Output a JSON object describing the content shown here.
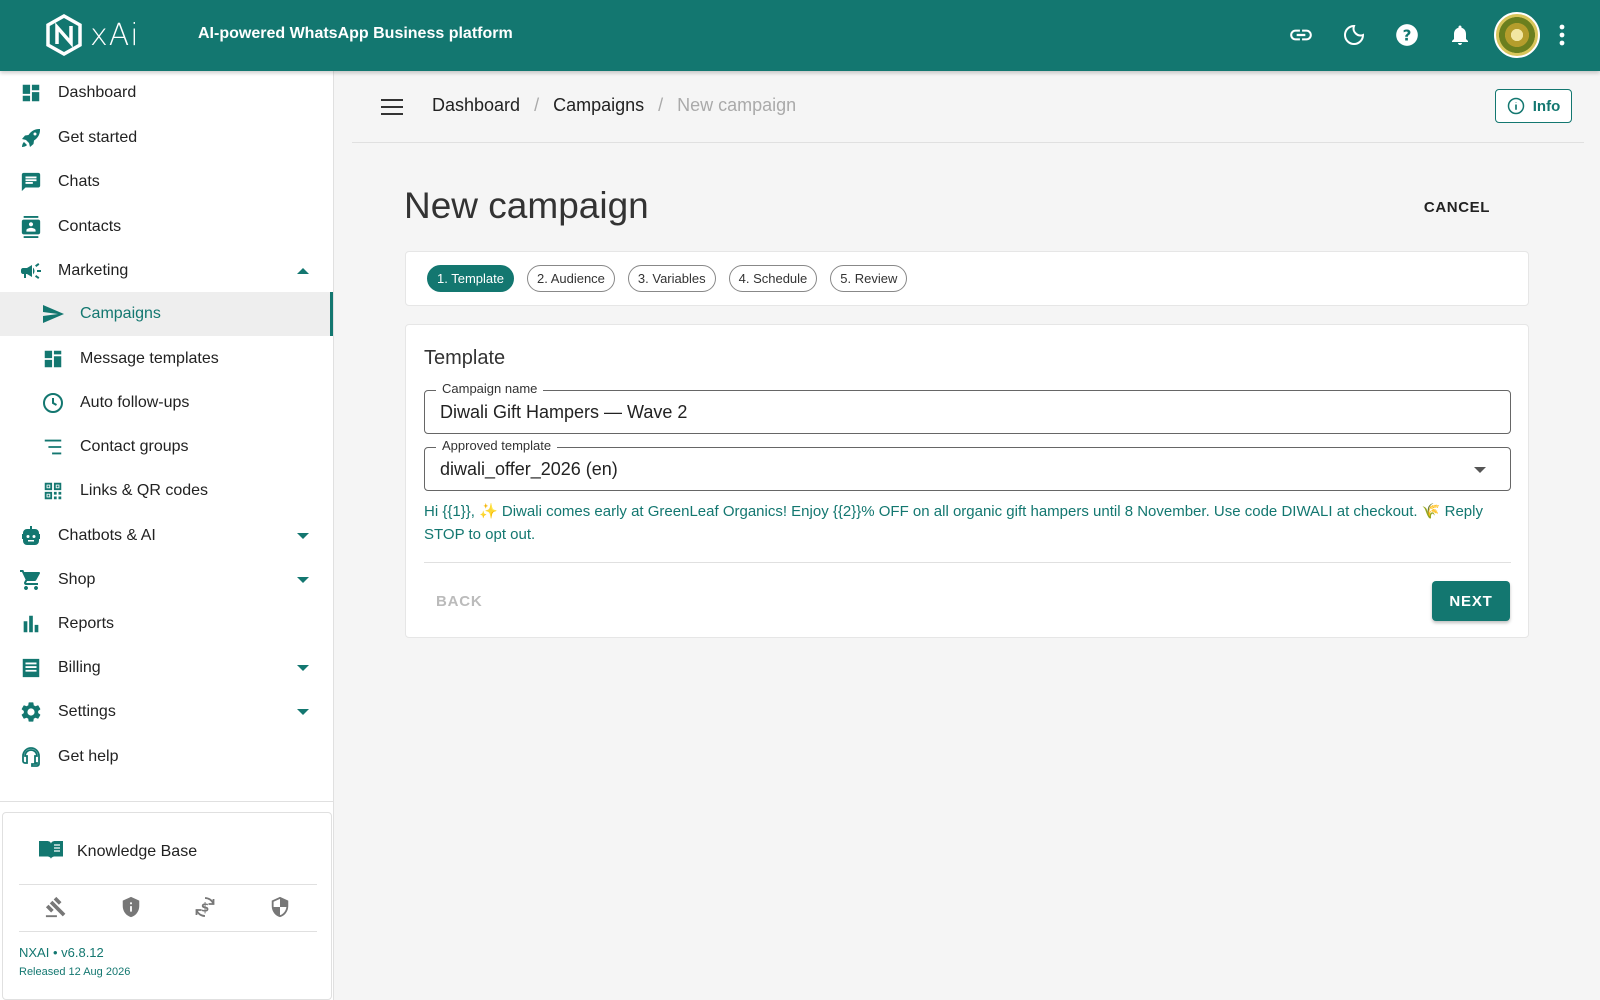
{
  "app": {
    "tagline": "AI-powered WhatsApp Business platform",
    "logo_text": "xAi",
    "accent_color": "#137770"
  },
  "header_icons": [
    "link-icon",
    "dark-mode-icon",
    "help-icon",
    "notifications-icon",
    "avatar",
    "more-vert-icon"
  ],
  "sidebar": {
    "items": [
      {
        "label": "Dashboard",
        "icon": "dashboard-icon"
      },
      {
        "label": "Get started",
        "icon": "rocket-icon"
      },
      {
        "label": "Chats",
        "icon": "chat-icon"
      },
      {
        "label": "Contacts",
        "icon": "contacts-icon"
      },
      {
        "label": "Marketing",
        "icon": "megaphone-icon",
        "expanded": true
      },
      {
        "label": "Campaigns",
        "icon": "send-icon",
        "active": true
      },
      {
        "label": "Message templates",
        "icon": "template-icon"
      },
      {
        "label": "Auto follow-ups",
        "icon": "clock-icon"
      },
      {
        "label": "Contact groups",
        "icon": "list-icon"
      },
      {
        "label": "Links & QR codes",
        "icon": "qr-code-icon"
      },
      {
        "label": "Chatbots & AI",
        "icon": "robot-icon"
      },
      {
        "label": "Shop",
        "icon": "cart-icon"
      },
      {
        "label": "Reports",
        "icon": "bar-chart-icon"
      },
      {
        "label": "Billing",
        "icon": "receipt-icon"
      },
      {
        "label": "Settings",
        "icon": "gear-icon"
      },
      {
        "label": "Get help",
        "icon": "support-icon"
      }
    ],
    "knowledge_base": "Knowledge Base",
    "footer_icons": [
      "gavel-icon",
      "privacy-shield-icon",
      "refund-icon",
      "security-shield-icon"
    ],
    "version": "NXAI • v6.8.12",
    "released": "Released 12 Aug 2026"
  },
  "breadcrumb": {
    "items": [
      "Dashboard",
      "Campaigns"
    ],
    "current": "New campaign"
  },
  "info_button": "Info",
  "page": {
    "title": "New campaign",
    "cancel": "CANCEL"
  },
  "steps": [
    "1. Template",
    "2. Audience",
    "3. Variables",
    "4. Schedule",
    "5. Review"
  ],
  "active_step": 0,
  "template_card": {
    "title": "Template",
    "campaign_name_label": "Campaign name",
    "campaign_name_value": "Diwali Gift Hampers — Wave 2",
    "approved_template_label": "Approved template",
    "approved_template_value": "diwali_offer_2026 (en)",
    "preview_text": "Hi {{1}}, ✨ Diwali comes early at GreenLeaf Organics! Enjoy {{2}}% OFF on all organic gift hampers until 8 November. Use code DIWALI at checkout. 🌾 Reply STOP to opt out.",
    "back": "BACK",
    "next": "NEXT"
  }
}
